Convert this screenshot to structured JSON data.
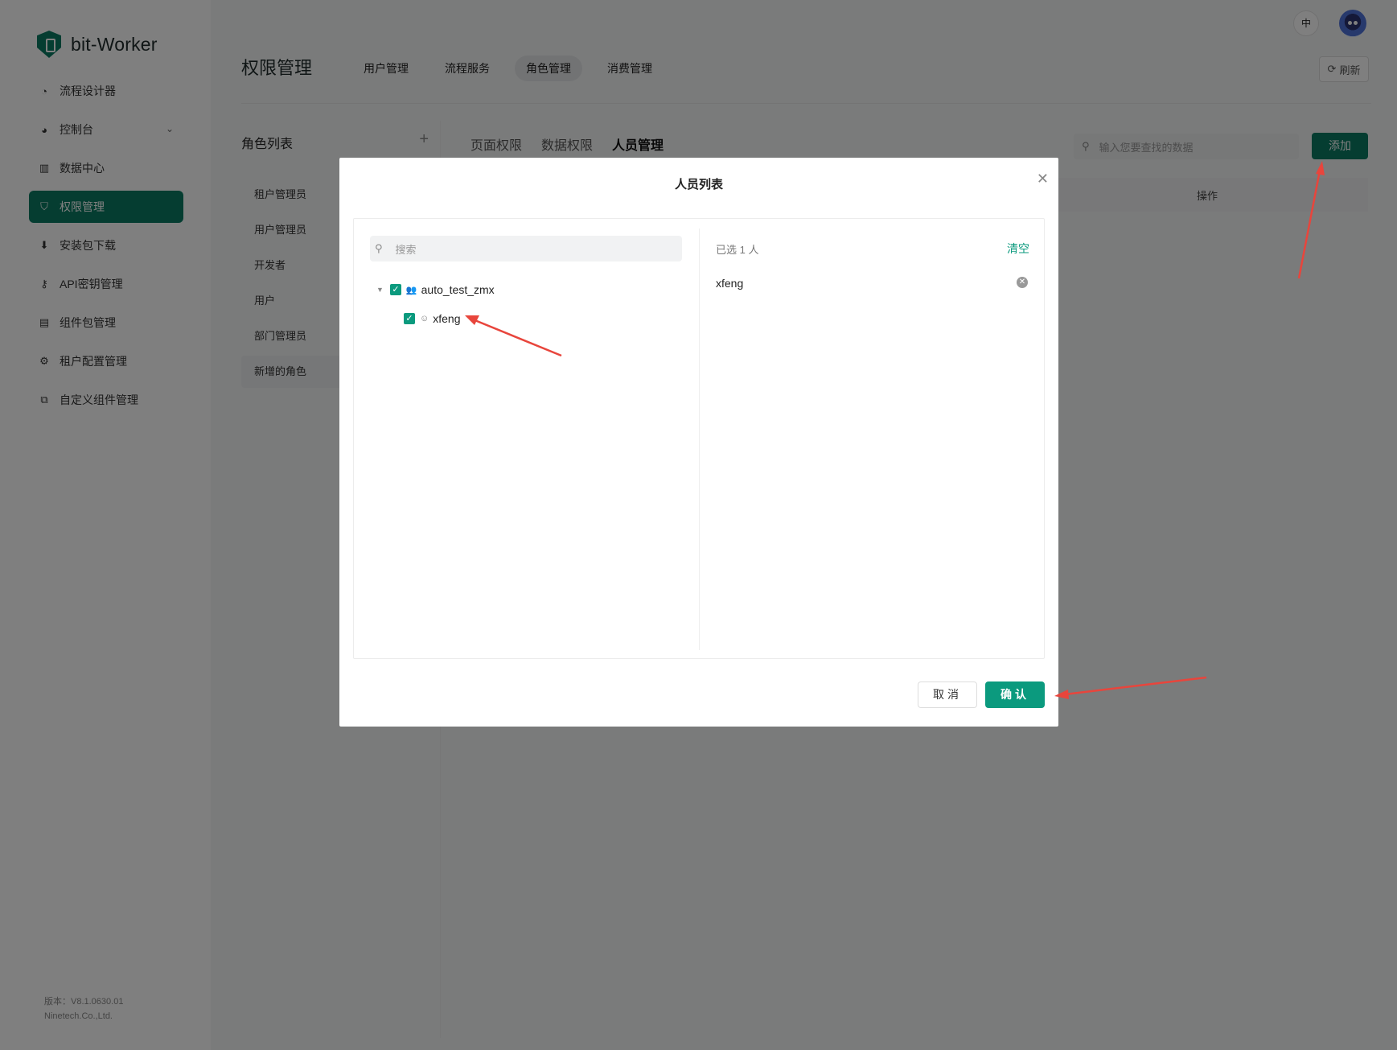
{
  "app": {
    "name": "bit-Worker"
  },
  "sidebar": {
    "items": [
      {
        "label": "流程设计器",
        "icon": "compass-icon"
      },
      {
        "label": "控制台",
        "icon": "pie-chart-icon"
      },
      {
        "label": "数据中心",
        "icon": "bar-chart-icon"
      },
      {
        "label": "权限管理",
        "icon": "shield-icon"
      },
      {
        "label": "安装包下载",
        "icon": "download-icon"
      },
      {
        "label": "API密钥管理",
        "icon": "key-icon"
      },
      {
        "label": "组件包管理",
        "icon": "package-icon"
      },
      {
        "label": "租户配置管理",
        "icon": "gear-icon"
      },
      {
        "label": "自定义组件管理",
        "icon": "custom-component-icon"
      }
    ],
    "version": "版本：V8.1.0630.01",
    "company": "Ninetech.Co.,Ltd."
  },
  "header": {
    "title": "权限管理",
    "tabs": [
      "用户管理",
      "流程服务",
      "角色管理",
      "消费管理"
    ],
    "lang": "中",
    "refresh": "刷新"
  },
  "role_panel": {
    "title": "角色列表",
    "roles": [
      "租户管理员",
      "用户管理员",
      "开发者",
      "用户",
      "部门管理员",
      "新增的角色"
    ]
  },
  "content": {
    "subtabs": [
      "页面权限",
      "数据权限",
      "人员管理"
    ],
    "search_placeholder": "输入您要查找的数据",
    "add_label": "添加",
    "col_operation": "操作"
  },
  "modal": {
    "title": "人员列表",
    "search_placeholder": "搜索",
    "tree": {
      "group": "auto_test_zmx",
      "member": "xfeng"
    },
    "selected_count": "已选 1 人",
    "clear": "清空",
    "selected_items": [
      "xfeng"
    ],
    "cancel": "取消",
    "confirm": "确认"
  },
  "colors": {
    "brand": "#0b7a63",
    "accent": "#0b9a7e",
    "annotation": "#e8453c"
  }
}
